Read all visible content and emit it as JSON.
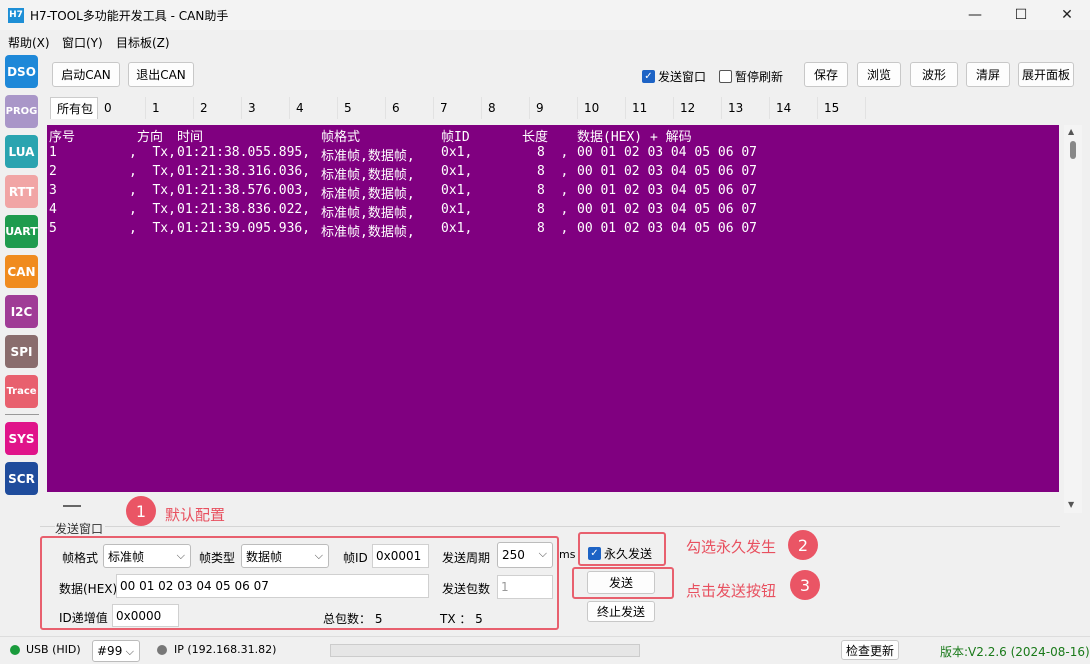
{
  "window": {
    "app_icon": "H7",
    "title": "H7-TOOL多功能开发工具 - CAN助手",
    "minimize_icon": "—",
    "maximize_icon": "☐",
    "close_icon": "✕"
  },
  "menu": [
    "帮助(X)",
    "窗口(Y)",
    "目标板(Z)"
  ],
  "sidebar": [
    {
      "label": "DSO",
      "color": "#1e88d8"
    },
    {
      "label": "PROG",
      "color": "#a996c8"
    },
    {
      "label": "LUA",
      "color": "#2aa4b0"
    },
    {
      "label": "RTT",
      "color": "#f1a5a5"
    },
    {
      "label": "UART",
      "color": "#1f9b4e"
    },
    {
      "label": "CAN",
      "color": "#f08b1e"
    },
    {
      "label": "I2C",
      "color": "#a03c96"
    },
    {
      "label": "SPI",
      "color": "#8a6d6d"
    },
    {
      "label": "Trace",
      "color": "#e8606e"
    },
    {
      "label": "SYS",
      "color": "#e0148a"
    },
    {
      "label": "SCR",
      "color": "#1f4c9c"
    }
  ],
  "toolbar": {
    "start_can": "启动CAN",
    "exit_can": "退出CAN",
    "send_window": "发送窗口",
    "send_window_checked": true,
    "pause_refresh": "暂停刷新",
    "pause_refresh_checked": false,
    "save": "保存",
    "browse": "浏览",
    "waveform": "波形",
    "clear": "清屏",
    "expand_panel": "展开面板"
  },
  "tabs": [
    "所有包",
    "0",
    "1",
    "2",
    "3",
    "4",
    "5",
    "6",
    "7",
    "8",
    "9",
    "10",
    "11",
    "12",
    "13",
    "14",
    "15"
  ],
  "log": {
    "header": {
      "seq": "序号",
      "dir": "方向",
      "time": "时间",
      "format": "帧格式",
      "id": "帧ID",
      "len": "长度",
      "data": "数据(HEX) + 解码"
    },
    "rows": [
      {
        "seq": "1",
        "dir": ",  Tx,",
        "time": "01:21:38.055.895,",
        "format": "标准帧,数据帧,",
        "id": "0x1,",
        "len": "8  ,",
        "data": "00 01 02 03 04 05 06 07"
      },
      {
        "seq": "2",
        "dir": ",  Tx,",
        "time": "01:21:38.316.036,",
        "format": "标准帧,数据帧,",
        "id": "0x1,",
        "len": "8  ,",
        "data": "00 01 02 03 04 05 06 07"
      },
      {
        "seq": "3",
        "dir": ",  Tx,",
        "time": "01:21:38.576.003,",
        "format": "标准帧,数据帧,",
        "id": "0x1,",
        "len": "8  ,",
        "data": "00 01 02 03 04 05 06 07"
      },
      {
        "seq": "4",
        "dir": ",  Tx,",
        "time": "01:21:38.836.022,",
        "format": "标准帧,数据帧,",
        "id": "0x1,",
        "len": "8  ,",
        "data": "00 01 02 03 04 05 06 07"
      },
      {
        "seq": "5",
        "dir": ",  Tx,",
        "time": "01:21:39.095.936,",
        "format": "标准帧,数据帧,",
        "id": "0x1,",
        "len": "8  ,",
        "data": "00 01 02 03 04 05 06 07"
      }
    ]
  },
  "send": {
    "group_label": "发送窗口",
    "frame_format_label": "帧格式",
    "frame_format_value": "标准帧",
    "frame_type_label": "帧类型",
    "frame_type_value": "数据帧",
    "frame_id_label": "帧ID",
    "frame_id_value": "0x0001",
    "period_label": "发送周期",
    "period_value": "250",
    "period_unit": "ms",
    "data_label": "数据(HEX)",
    "data_value": "00 01 02 03 04 05 06 07",
    "count_label": "发送包数",
    "count_value": "1",
    "id_inc_label": "ID递增值",
    "id_inc_value": "0x0000",
    "total_label": "总包数： 5",
    "tx_label": "TX ： 5",
    "forever_label": "永久发送",
    "forever_checked": true,
    "send_button": "发送",
    "stop_button": "终止发送"
  },
  "annotations": [
    {
      "num": "1",
      "text": "默认配置"
    },
    {
      "num": "2",
      "text": "勾选永久发生"
    },
    {
      "num": "3",
      "text": "点击发送按钮"
    }
  ],
  "status": {
    "usb": "USB (HID)",
    "device": "#99",
    "ip": "IP (192.168.31.82)",
    "check_update": "检查更新",
    "version": "版本:V2.2.6 (2024-08-16)",
    "usb_color": "#1a9b3c",
    "ip_color": "#777777",
    "version_color": "#1a7a1a"
  }
}
